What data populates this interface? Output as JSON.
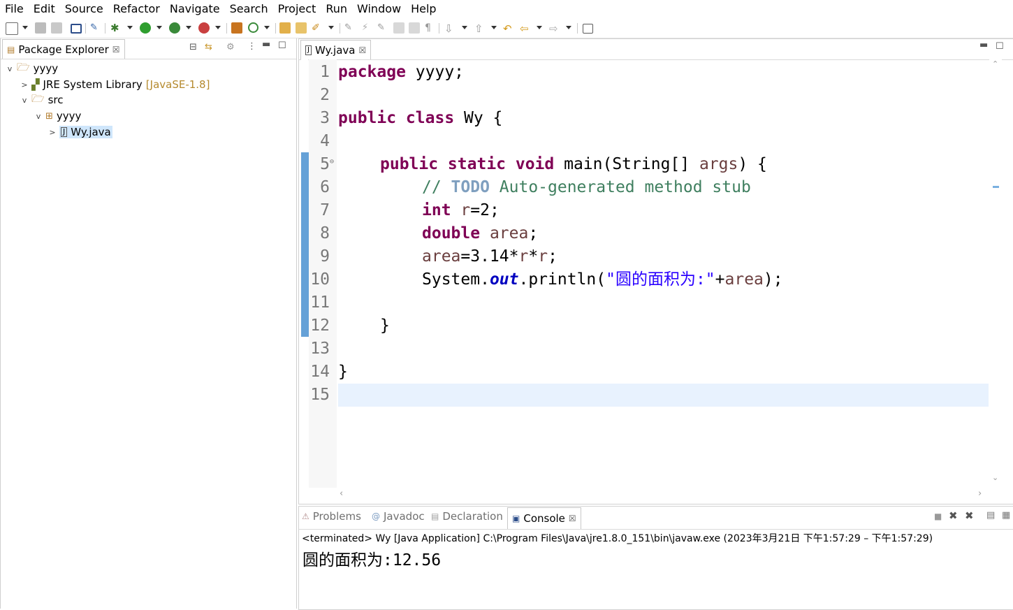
{
  "menu": [
    "File",
    "Edit",
    "Source",
    "Refactor",
    "Navigate",
    "Search",
    "Project",
    "Run",
    "Window",
    "Help"
  ],
  "package_explorer": {
    "title": "Package Explorer",
    "tree": [
      {
        "label": "yyyy",
        "expanded": "v",
        "icon": "project-icon"
      },
      {
        "label": "JRE System Library",
        "decor": "[JavaSE-1.8]",
        "expanded": ">",
        "icon": "library-icon"
      },
      {
        "label": "src",
        "expanded": "v",
        "icon": "source-folder-icon"
      },
      {
        "label": "yyyy",
        "expanded": "v",
        "icon": "package-icon"
      },
      {
        "label": "Wy.java",
        "expanded": ">",
        "icon": "java-file-icon"
      }
    ]
  },
  "editor": {
    "tab": "Wy.java",
    "lines": [
      {
        "n": "1"
      },
      {
        "n": "2"
      },
      {
        "n": "3"
      },
      {
        "n": "4"
      },
      {
        "n": "5"
      },
      {
        "n": "6"
      },
      {
        "n": "7"
      },
      {
        "n": "8"
      },
      {
        "n": "9"
      },
      {
        "n": "10"
      },
      {
        "n": "11"
      },
      {
        "n": "12"
      },
      {
        "n": "13"
      },
      {
        "n": "14"
      },
      {
        "n": "15"
      }
    ],
    "code": {
      "l1_kw": "package",
      "l1_rest": " yyyy;",
      "l3_kw": "public class",
      "l3_rest": " Wy {",
      "l5_kw": "public static void",
      "l5_a": " main(String[] ",
      "l5_var": "args",
      "l5_b": ") {",
      "l6_c1": "// ",
      "l6_todo": "TODO",
      "l6_c2": " Auto-generated method stub",
      "l7_kw": "int",
      "l7_var": " r",
      "l7_rest": "=2;",
      "l8_kw": "double",
      "l8_var": " area",
      "l8_rest": ";",
      "l9_var1": "area",
      "l9_a": "=3.14*",
      "l9_var2": "r",
      "l9_b": "*",
      "l9_var3": "r",
      "l9_c": ";",
      "l10_a": "System.",
      "l10_fld": "out",
      "l10_b": ".println(",
      "l10_str": "\"圆的面积为:\"",
      "l10_c": "+",
      "l10_var": "area",
      "l10_d": ");",
      "l12": "}",
      "l14": "}"
    }
  },
  "console": {
    "tabs": [
      "Problems",
      "Javadoc",
      "Declaration",
      "Console"
    ],
    "status": "<terminated> Wy [Java Application] C:\\Program Files\\Java\\jre1.8.0_151\\bin\\javaw.exe  (2023年3月21日 下午1:57:29 – 下午1:57:29)",
    "output": "圆的面积为:12.56"
  }
}
